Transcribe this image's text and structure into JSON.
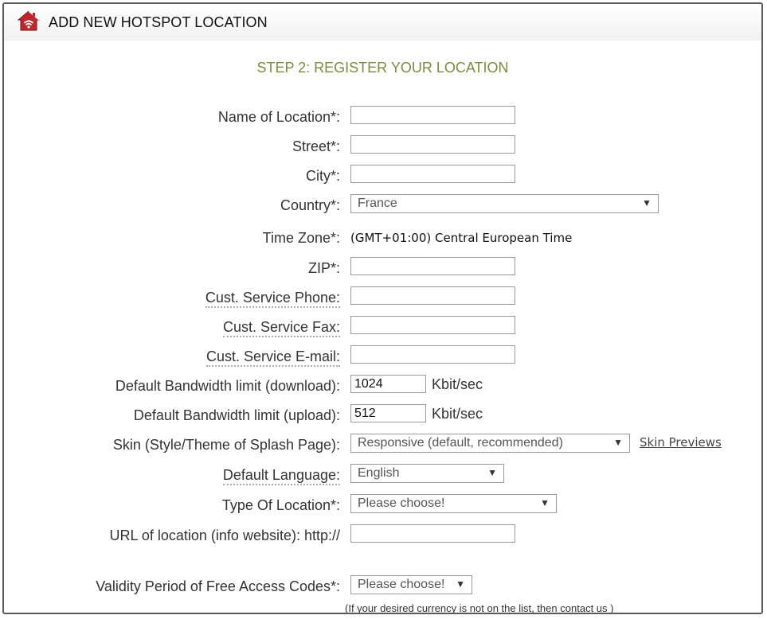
{
  "header": {
    "title": "ADD NEW HOTSPOT LOCATION",
    "icon": "home-wifi-icon",
    "icon_color": "#c0272d"
  },
  "step_title": "STEP 2: REGISTER YOUR LOCATION",
  "accent_color": "#7c8a45",
  "form": {
    "name_label": "Name of Location*:",
    "name_value": "",
    "street_label": "Street*:",
    "street_value": "",
    "city_label": "City*:",
    "city_value": "",
    "country_label": "Country*:",
    "country_value": "France",
    "timezone_label": "Time Zone*:",
    "timezone_value": "(GMT+01:00) Central European Time",
    "zip_label": "ZIP*:",
    "zip_value": "",
    "phone_label": "Cust. Service Phone:",
    "phone_value": "",
    "fax_label": "Cust. Service Fax:",
    "fax_value": "",
    "email_label": "Cust. Service E-mail:",
    "email_value": "",
    "bw_down_label": "Default Bandwidth limit (download):",
    "bw_down_value": "1024",
    "bw_up_label": "Default Bandwidth limit (upload):",
    "bw_up_value": "512",
    "bw_unit": "Kbit/sec",
    "skin_label": "Skin (Style/Theme of Splash Page):",
    "skin_value": "Responsive (default, recommended)",
    "skin_previews_link": "Skin Previews",
    "language_label": "Default Language:",
    "language_value": "English",
    "type_label": "Type Of Location*:",
    "type_value": "Please choose!",
    "url_label": "URL of location (info website): http://",
    "url_value": "",
    "validity_label": "Validity Period of Free Access Codes*:",
    "validity_value": "Please choose!"
  },
  "footnote": {
    "prefix": "(If your desired currency is not on the list, then",
    "link": "contact us",
    "suffix": ")"
  }
}
